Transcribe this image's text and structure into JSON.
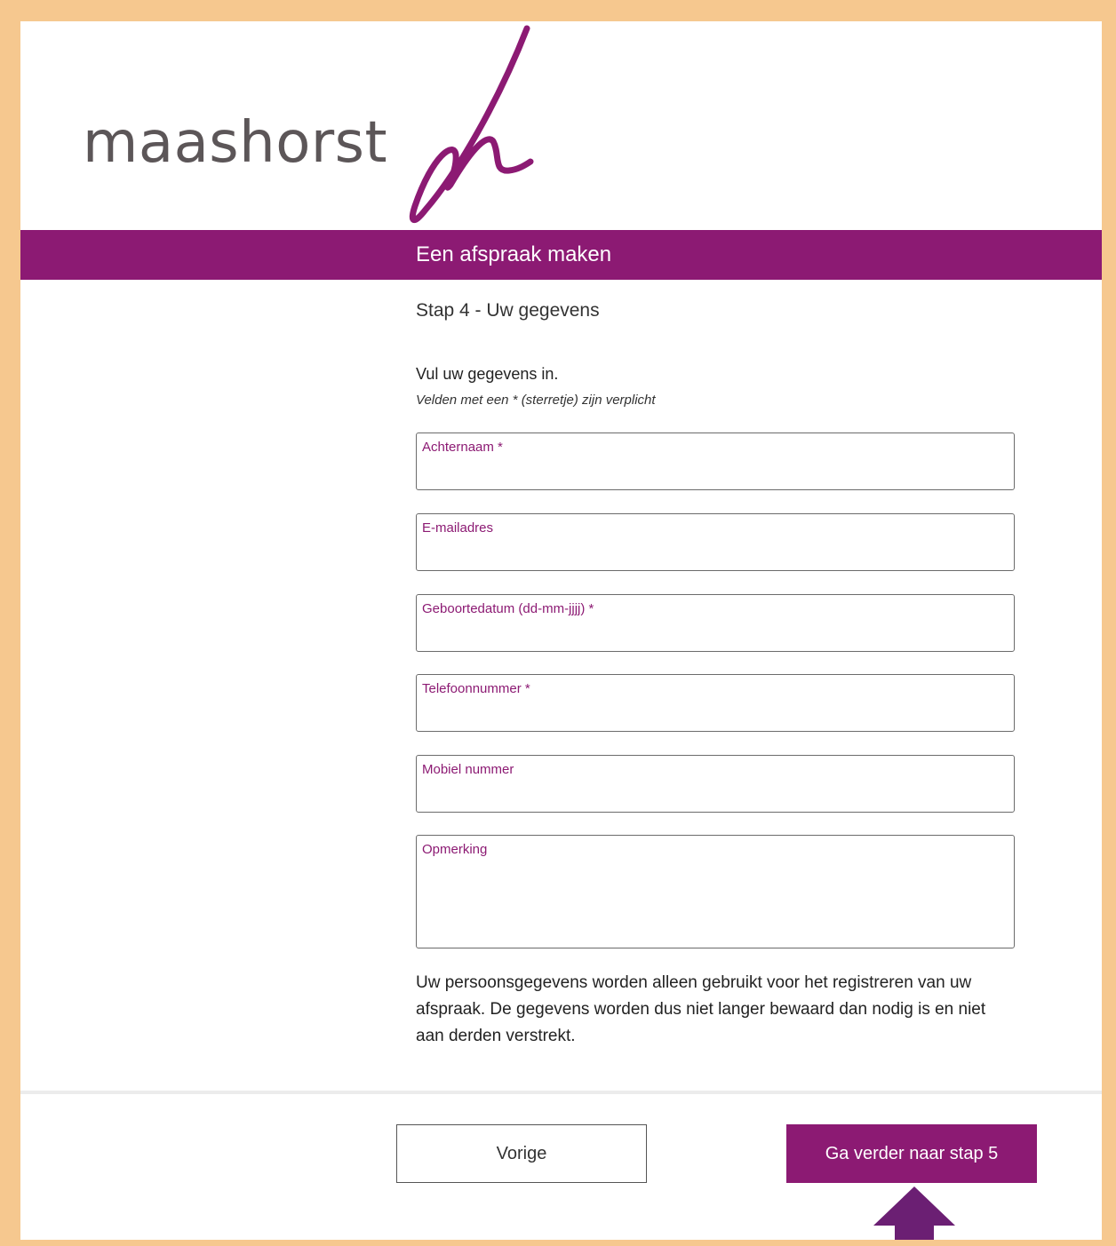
{
  "logo": {
    "text": "maashorst",
    "brand_color": "#8c1a73",
    "text_color": "#5c5658"
  },
  "header": {
    "title": "Een afspraak maken",
    "bar_color": "#8c1a73"
  },
  "step": {
    "title": "Stap 4 - Uw gegevens"
  },
  "form": {
    "intro": "Vul uw gegevens in.",
    "required_note": "Velden met een * (sterretje) zijn verplicht",
    "fields": [
      {
        "label": "Achternaam *",
        "value": ""
      },
      {
        "label": "E-mailadres",
        "value": ""
      },
      {
        "label": "Geboortedatum (dd-mm-jjjj) *",
        "value": ""
      },
      {
        "label": "Telefoonnummer *",
        "value": ""
      },
      {
        "label": "Mobiel nummer",
        "value": ""
      },
      {
        "label": "Opmerking",
        "value": ""
      }
    ]
  },
  "privacy_text": "Uw persoonsgegevens worden alleen gebruikt voor het registreren van uw afspraak. De gegevens worden dus niet langer bewaard dan nodig is en niet aan derden verstrekt.",
  "buttons": {
    "previous": "Vorige",
    "next": "Ga verder naar stap 5"
  },
  "icons": {
    "brand_mark": "maashorst-m-logo-icon",
    "annotation_arrow": "arrow-up-icon"
  },
  "colors": {
    "frame": "#f6c88f",
    "accent": "#8c1a73",
    "arrow": "#6b1f73"
  }
}
